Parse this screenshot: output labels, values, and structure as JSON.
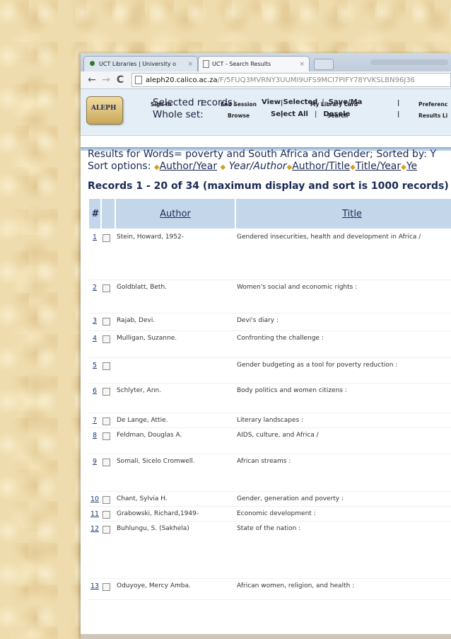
{
  "browser": {
    "tabs": [
      {
        "label": "UCT Libraries | University o",
        "close": "×"
      },
      {
        "label": "UCT - Search Results",
        "close": "×"
      }
    ],
    "url_host": "aleph20.calico.ac.za",
    "url_path": "/F/5FUQ3MVRNY3UUMI9UFS9MCI7PIFY78YVKSLBN96J36"
  },
  "menu": {
    "logo": "ALEPH",
    "row1": [
      "Sign-in",
      "End Session",
      "My Library Card",
      "Preferenc"
    ],
    "row2": [
      "Browse",
      "Search",
      "Results Li"
    ],
    "sep": "|"
  },
  "selection": {
    "selected_label": "Selected records:",
    "view_selected": "View Selected",
    "save_mail": "Save/Ma",
    "whole_label": "Whole set:",
    "select_all": "Select All",
    "deselect": "Desele",
    "sep": "|"
  },
  "results": {
    "query_line": "Results for Words= poverty and South Africa and Gender; Sorted by: Y",
    "sort_label": "Sort options:",
    "sort_options": [
      "Author/Year",
      "Year/Author",
      "Author/Title",
      "Title/Year",
      "Ye"
    ],
    "records_line": "Records 1 - 20 of 34 (maximum display and sort is 1000 records)"
  },
  "table": {
    "headers": {
      "num": "#",
      "author": "Author",
      "title": "Title"
    },
    "rows": [
      {
        "n": "1",
        "author": "Stein, Howard, 1952-",
        "title": "Gendered insecurities, health and development in Africa /"
      },
      {
        "n": "2",
        "author": "Goldblatt, Beth.",
        "title": "Women's social and economic rights :"
      },
      {
        "n": "3",
        "author": "Rajab, Devi.",
        "title": "Devi's diary :"
      },
      {
        "n": "4",
        "author": "Mulligan, Suzanne.",
        "title": "Confronting the challenge :"
      },
      {
        "n": "5",
        "author": "",
        "title": "Gender budgeting as a tool for poverty reduction :"
      },
      {
        "n": "6",
        "author": "Schlyter, Ann.",
        "title": "Body politics and women citizens :"
      },
      {
        "n": "7",
        "author": "De Lange, Attie.",
        "title": "Literary landscapes :"
      },
      {
        "n": "8",
        "author": "Feldman, Douglas A.",
        "title": "AIDS, culture, and Africa /"
      },
      {
        "n": "9",
        "author": "Somali, Sicelo Cromwell.",
        "title": "African streams :"
      },
      {
        "n": "10",
        "author": "Chant, Sylvia H.",
        "title": "Gender, generation and poverty :"
      },
      {
        "n": "11",
        "author": "Grabowski, Richard,1949-",
        "title": "Economic development :"
      },
      {
        "n": "12",
        "author": "Buhlungu, S. (Sakhela)",
        "title": "State of the nation :"
      },
      {
        "n": "13",
        "author": "Oduyoye, Mercy Amba.",
        "title": "African women, religion, and health :"
      }
    ]
  }
}
